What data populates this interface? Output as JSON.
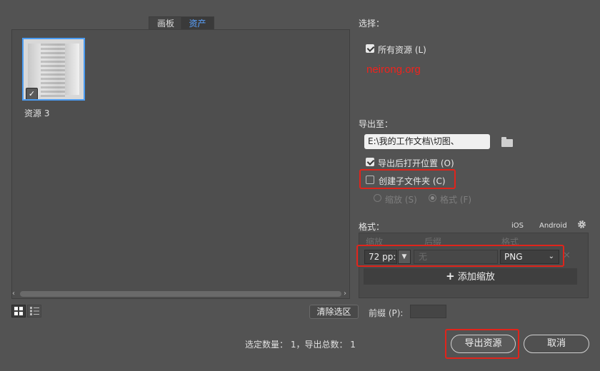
{
  "tabs": {
    "artboards": "画板",
    "assets": "资产"
  },
  "assets": [
    {
      "name": "资源 3",
      "selected": true
    }
  ],
  "select_section": {
    "title": "选择：",
    "all_assets_label": "所有资源 (L)",
    "all_assets_checked": true
  },
  "watermark": "neirong.org",
  "export_to": {
    "title": "导出至：",
    "path": "E:\\我的工作文档\\切图、",
    "open_after_label": "导出后打开位置 (O)",
    "open_after_checked": true,
    "subfolder_label": "创建子文件夹 (C)",
    "subfolder_checked": false,
    "scale_option_label": "缩放 (S)",
    "format_option_label": "格式 (F)",
    "selected_option": "format"
  },
  "format_section": {
    "title": "格式：",
    "ios_label": "iOS",
    "android_label": "Android",
    "columns": {
      "scale": "缩放",
      "suffix": "后缀",
      "format": "格式"
    },
    "row": {
      "scale_value": "72 pp:",
      "suffix_placeholder": "无",
      "format_value": "PNG"
    },
    "add_scale_label": "添加缩放"
  },
  "bottom": {
    "clear_selection": "清除选区",
    "prefix_label": "前缀 (P):",
    "prefix_value": "",
    "count_text": "选定数量：  1，导出总数：  1",
    "export_button": "导出资源",
    "cancel_button": "取消"
  },
  "colors": {
    "accent": "#4b9cf2",
    "highlight_red": "#e0241b",
    "background": "#535353"
  }
}
